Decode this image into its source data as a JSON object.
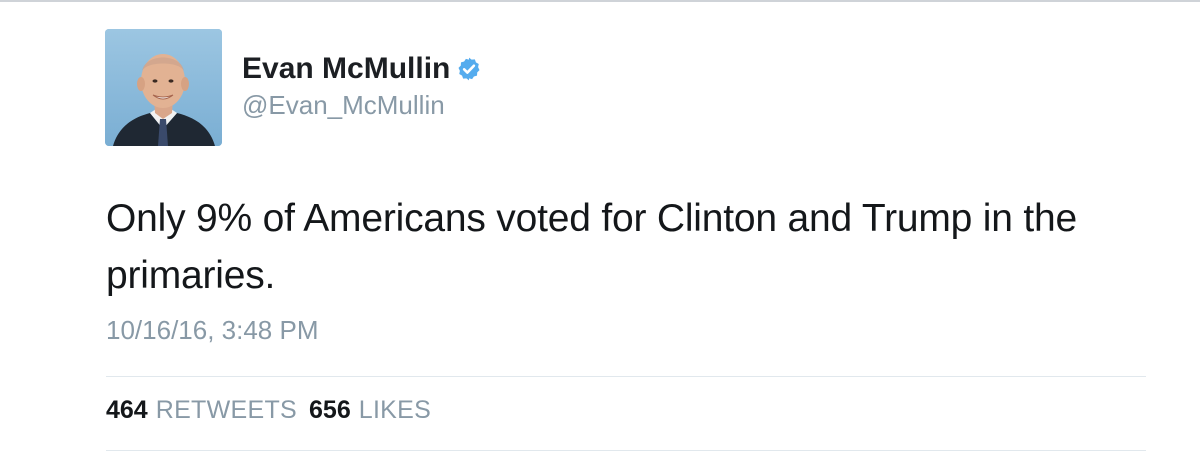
{
  "tweet": {
    "author": {
      "display_name": "Evan McMullin",
      "handle": "@Evan_McMullin",
      "verified": true,
      "verified_color": "#55acee"
    },
    "text": "Only 9% of Americans voted for Clinton and Trump in the primaries.",
    "timestamp": "10/16/16, 3:48 PM",
    "stats": {
      "retweets_count": "464",
      "retweets_label": "RETWEETS",
      "likes_count": "656",
      "likes_label": "LIKES"
    }
  },
  "colors": {
    "text": "#14171a",
    "secondary": "#8899a6",
    "divider": "#e1e8ed",
    "avatar_bg": "#8fbbd8"
  }
}
